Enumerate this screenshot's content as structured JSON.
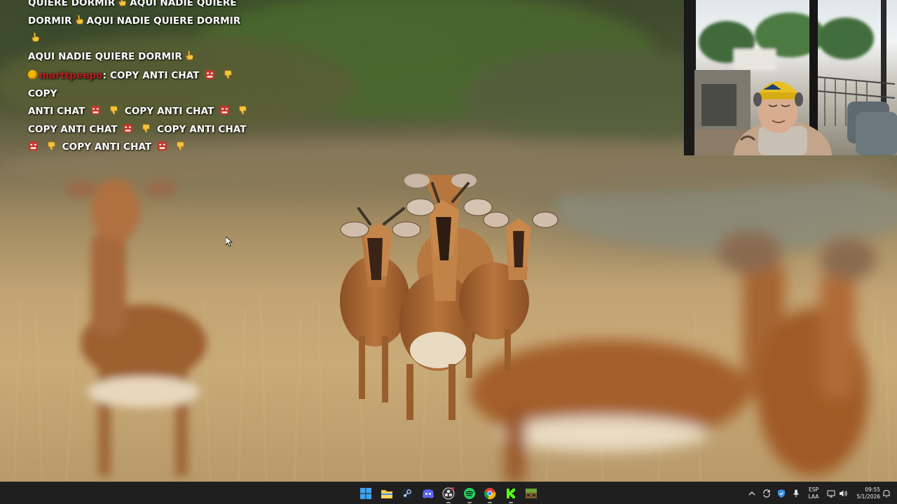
{
  "chat": {
    "message_1": {
      "lines": [
        "QUIERE DORMIR",
        "AQUI NADIE QUIERE",
        "DORMIR",
        "AQUI NADIE QUIERE DORMIR",
        "AQUI NADIE QUIERE DORMIR"
      ],
      "emoji": "pointing-up-hand-emoji"
    },
    "message_2": {
      "username": "marttpeepo",
      "separator": ":",
      "text_parts": [
        "COPY ANTI CHAT",
        "COPY",
        "ANTI CHAT",
        "COPY ANTI CHAT",
        "COPY ANTI CHAT",
        "COPY ANTI CHAT",
        "COPY ANTI CHAT"
      ],
      "emojis": [
        "angry-face-emoji",
        "thumbs-down-emoji"
      ]
    }
  },
  "taskbar": {
    "pinned_apps": [
      "windows-start-icon",
      "file-explorer-icon",
      "steam-icon",
      "discord-icon",
      "obs-icon",
      "spotify-icon",
      "chrome-icon",
      "kick-icon",
      "minecraft-icon"
    ],
    "tray": {
      "language_top": "ESP",
      "language_bottom": "LAA",
      "time": "09:55",
      "date": "5/1/2026"
    }
  },
  "colors": {
    "taskbar_bg": "#1f1f1f",
    "username": "#b71c1c",
    "chat_text": "#ffffff"
  }
}
